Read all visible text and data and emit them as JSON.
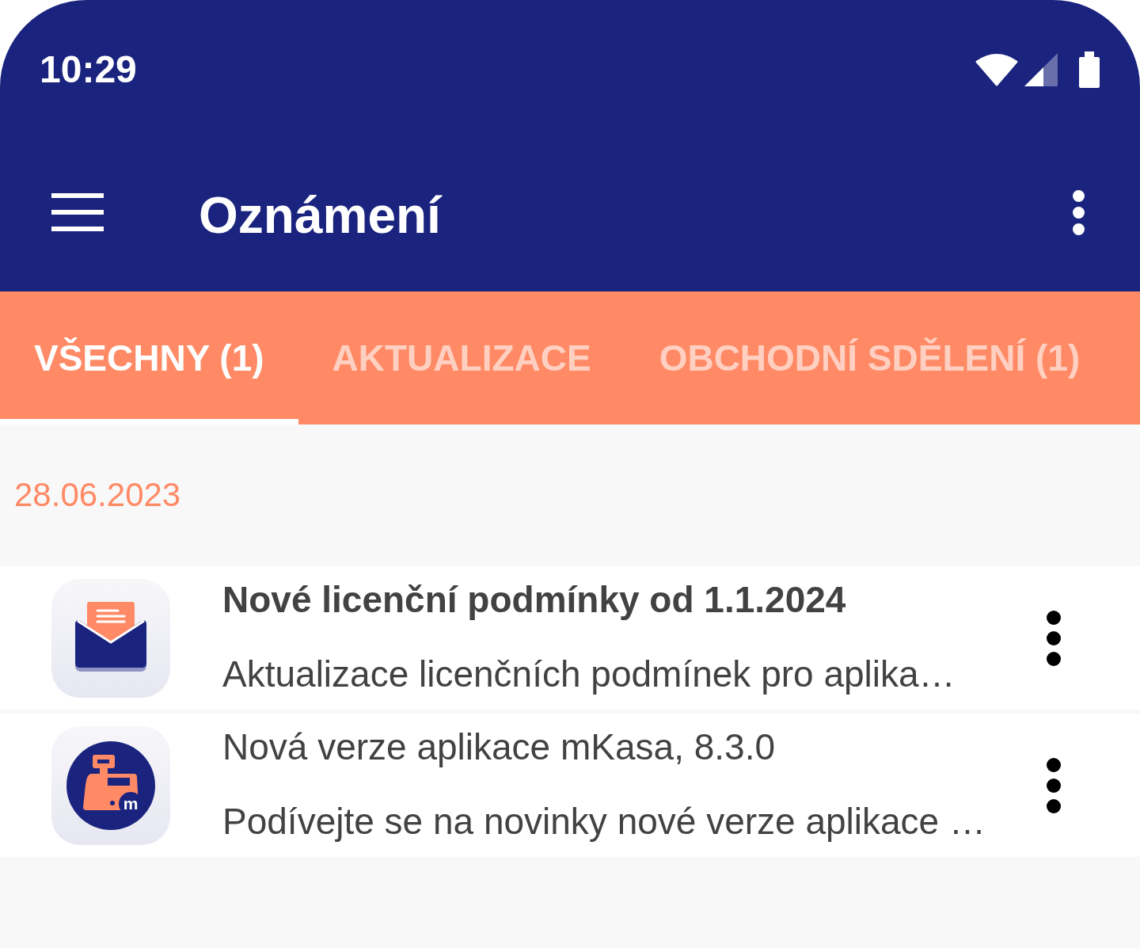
{
  "status_bar": {
    "time": "10:29"
  },
  "app_bar": {
    "title": "Oznámení"
  },
  "tabs": [
    {
      "label": "VŠECHNY (1)",
      "selected": true
    },
    {
      "label": "AKTUALIZACE",
      "selected": false
    },
    {
      "label": "OBCHODNÍ SDĚLENÍ (1)",
      "selected": false
    }
  ],
  "sections": [
    {
      "date": "28.06.2023",
      "notifications": [
        {
          "kind": "envelope",
          "title": "Nové licenční podmínky od 1.1.2024",
          "summary": "Aktualizace licenčních podmínek pro aplika…",
          "unread": true
        },
        {
          "kind": "cash_register",
          "badge": "m",
          "title": "Nová verze aplikace mKasa, 8.3.0",
          "summary": "Podívejte se na novinky nové verze aplikace …",
          "unread": false
        }
      ]
    }
  ]
}
